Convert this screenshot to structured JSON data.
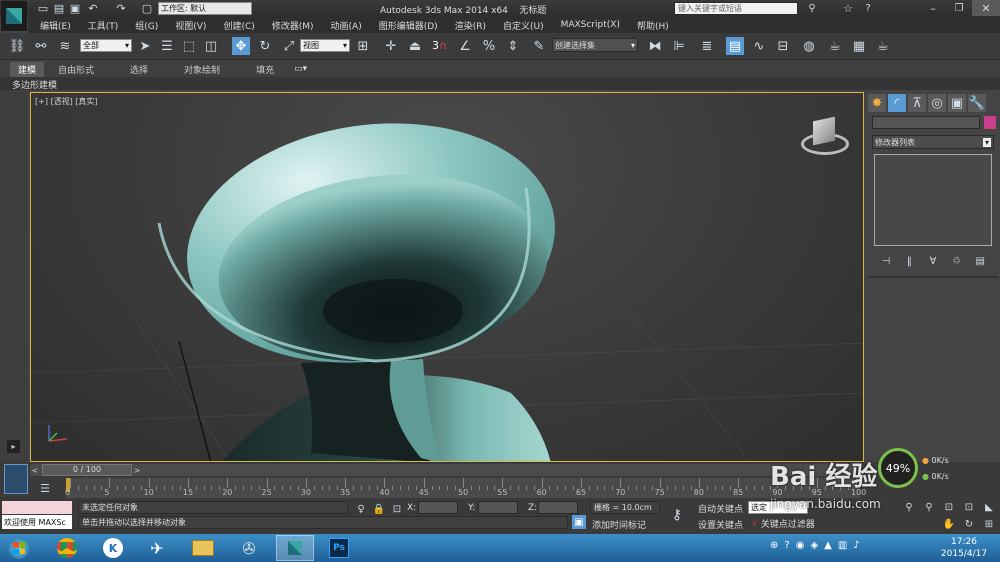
{
  "titlebar": {
    "workspace_label": "工作区: 默认",
    "app_title": "Autodesk 3ds Max  2014 x64",
    "doc_title": "无标题",
    "search_placeholder": "键入关键字或短语"
  },
  "menu": [
    "编辑(E)",
    "工具(T)",
    "组(G)",
    "视图(V)",
    "创建(C)",
    "修改器(M)",
    "动画(A)",
    "图形编辑器(D)",
    "渲染(R)",
    "自定义(U)",
    "MAXScript(X)",
    "帮助(H)"
  ],
  "toolbar": {
    "filter_value": "全部",
    "refcoord_value": "视图",
    "snap_label": "3",
    "selection_set_value": "创建选择集"
  },
  "ribbon": {
    "tabs": [
      "建模",
      "自由形式",
      "选择",
      "对象绘制",
      "填充"
    ],
    "sub_label": "多边形建模"
  },
  "viewport": {
    "label": "[+] [透视] [真实]"
  },
  "panel": {
    "modifier_list": "修改器列表"
  },
  "timeline": {
    "frame": "0 / 100",
    "ticks": [
      "0",
      "5",
      "10",
      "15",
      "20",
      "25",
      "30",
      "35",
      "40",
      "45",
      "50",
      "55",
      "60",
      "65",
      "70",
      "75",
      "80",
      "85",
      "90",
      "95",
      "100"
    ]
  },
  "status": {
    "maxscript_label": "欢迎使用 MAXSc",
    "line1": "未选定任何对象",
    "line2": "单击并拖动以选择并移动对象",
    "x_label": "X:",
    "y_label": "Y:",
    "z_label": "Z:",
    "grid": "栅格 = 10.0cm",
    "add_time_tag": "添加时间标记",
    "auto_key": "自动关键点",
    "set_key": "设置关键点",
    "selected": "选定",
    "key_filters": "关键点过滤器"
  },
  "hud": {
    "cpu": "49%",
    "net_up": "0K/s",
    "net_down": "0K/s"
  },
  "taskbar": {
    "time": "17:26",
    "date": "2015/4/17"
  },
  "watermark": {
    "text": "Bai 经验",
    "url": "jingyan.baidu.com"
  },
  "colors": {
    "accent": "#5b9bd5",
    "viewport_border": "#d8b64a",
    "vase": "#7fbdb8",
    "swatch": "#c8408c"
  }
}
